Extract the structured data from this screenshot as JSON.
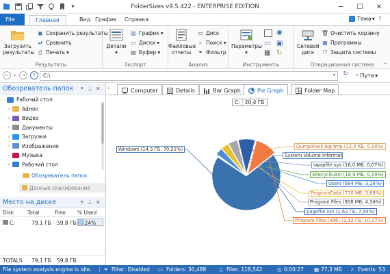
{
  "titlebar": {
    "title": "FolderSizes v9.5.422 - ENTERPRISE EDITION"
  },
  "ribbon_tabs": {
    "file": "File",
    "main": "Главная",
    "view": "Вид",
    "graph": "График",
    "help": "Справка",
    "theme": "Тема"
  },
  "ribbon": {
    "results": {
      "label": "Результаты",
      "load": "Загрузить\nрезультаты",
      "save": "Сохранить результаты",
      "compare": "Сравнить",
      "print": "Печать"
    },
    "export": {
      "label": "Экспорт",
      "details": "Детали",
      "graph": "График",
      "disks": "Диски",
      "buffer": "Буфер"
    },
    "analysis": {
      "label": "Анализ",
      "file_reports": "Файловые\nотчеты",
      "disk": "Диск",
      "search": "Поиск",
      "filter": "Фильтр"
    },
    "tools": {
      "label": "Инструменты",
      "params": "Параметры"
    },
    "os": {
      "label": "Операционная система",
      "net_disk": "Сетевой\nдиск",
      "clean_bin": "Очистить корзину",
      "programs": "Программы",
      "protect": "Защита системы"
    }
  },
  "address": {
    "path": "C:\\",
    "paths_btn": "Пути"
  },
  "folder_browser": {
    "title": "Обозреватель папок",
    "items": [
      {
        "label": "Рабочий стол",
        "color": "#2f7fd6"
      },
      {
        "label": "Admin",
        "color": "#e8b54a"
      },
      {
        "label": "Видео",
        "color": "#7e57c2"
      },
      {
        "label": "Документы",
        "color": "#8d8d8d"
      },
      {
        "label": "Загрузки",
        "color": "#2196f3"
      },
      {
        "label": "Изображения",
        "color": "#5c8fd6"
      },
      {
        "label": "Музыка",
        "color": "#c2185b"
      },
      {
        "label": "Рабочий стол",
        "color": "#2f7fd6"
      }
    ],
    "tab_browser": "Обозреватель папок",
    "tab_scan": "Данные сканирования"
  },
  "disk_space": {
    "title": "Место на диске",
    "columns": [
      "Disk",
      "Total",
      "Free",
      "% Used"
    ],
    "rows": [
      {
        "disk": "C:",
        "total": "79,1 ГБ",
        "free": "59,8 ГБ",
        "used": "24%",
        "used_frac": 0.24
      }
    ],
    "totals_label": "TOTALS:",
    "totals_total": "79,1 ГБ",
    "totals_free": "59,8 ГБ"
  },
  "view_tabs": [
    "Computer",
    "Details",
    "Bar Graph",
    "Pie Graph",
    "Folder Map"
  ],
  "chart_data": {
    "type": "pie",
    "title": "C:",
    "total": "20,4 ГБ",
    "slices": [
      {
        "label": "Windows (14,3 ГБ, 70,21%)",
        "value": 70.21,
        "color": "#3a72b0"
      },
      {
        "label": "DumpStack.log.tmp (12,0 КБ, 0,00%)",
        "value": 0.0,
        "color": "#e0b070"
      },
      {
        "label": "System Volume Information (20,0 КБ, 0,00%)",
        "value": 0.0,
        "color": "#5a8ccc"
      },
      {
        "label": "swapfile.sys (16,0 МБ, 0,07%)",
        "value": 0.07,
        "color": "#7a9bd0"
      },
      {
        "label": "$Recycle.Bin (18,9 МБ, 0,09%)",
        "value": 0.09,
        "color": "#6aab4a"
      },
      {
        "label": "Users (684 МБ, 3,26%)",
        "value": 3.26,
        "color": "#4a8fd8"
      },
      {
        "label": "ProgramData (770 МБ, 3,68%)",
        "value": 3.68,
        "color": "#e8c030"
      },
      {
        "label": "Program Files (908 МБ, 4,34%)",
        "value": 4.34,
        "color": "#a8a8a8"
      },
      {
        "label": "pagefile.sys (1,62 ГБ, 7,94%)",
        "value": 7.94,
        "color": "#2d5fa8"
      },
      {
        "label": "Program Files (x86) (2,12 ГБ, 10,37%)",
        "value": 10.37,
        "color": "#f07a40"
      }
    ]
  },
  "status": {
    "engine": "File system analysis engine is idle.",
    "filter": "Filter: Disabled",
    "folders": "Folders: 30,488",
    "files": "Files: 118,542",
    "time": "0:00:27",
    "mem": "77,3 МБ",
    "events": "Events: 53"
  }
}
